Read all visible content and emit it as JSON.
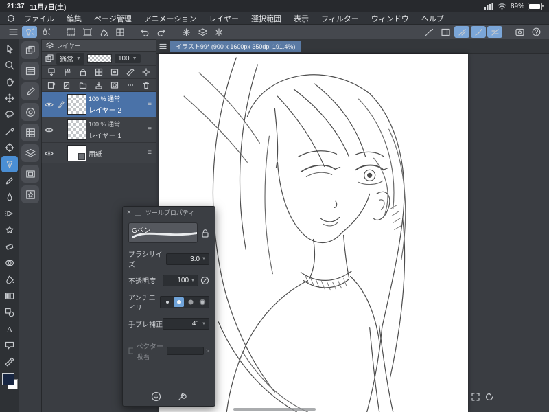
{
  "status_bar": {
    "time": "21:37",
    "date": "11月7日(土)",
    "battery_percent": "89%"
  },
  "menu_bar": {
    "items": [
      "ファイル",
      "編集",
      "ページ管理",
      "アニメーション",
      "レイヤー",
      "選択範囲",
      "表示",
      "フィルター",
      "ウィンドウ",
      "ヘルプ"
    ]
  },
  "document_tab": {
    "title": "イラスト99* (900 x 1600px 350dpi 191.4%)"
  },
  "layers_panel": {
    "title": "レイヤー",
    "blend_mode": "通常",
    "opacity_value": "100",
    "layers": [
      {
        "info": "100 % 通常",
        "name": "レイヤー 2"
      },
      {
        "info": "100 % 通常",
        "name": "レイヤー 1"
      },
      {
        "info": "",
        "name": "用紙"
      }
    ]
  },
  "tool_property": {
    "window_title": "ツールプロパティ",
    "close_glyph": "×",
    "min_glyph": "＿",
    "tool_name": "Gペン",
    "brush_size_label": "ブラシサイズ",
    "brush_size_value": "3.0",
    "opacity_label": "不透明度",
    "opacity_value": "100",
    "antialias_label": "アンチエイリ",
    "stabilization_label": "手ブレ補正",
    "stabilization_value": "41",
    "vector_snap_label": "ベクター吸着",
    "vector_snap_chevron": ">"
  },
  "colors": {
    "selected_layer_blue": "#4a72a8",
    "selected_tool_blue": "#4a8ed4",
    "toolbar_active_blue": "#7ba6d8",
    "foreground_swatch": "#182642",
    "canvas_white": "#ffffff"
  }
}
